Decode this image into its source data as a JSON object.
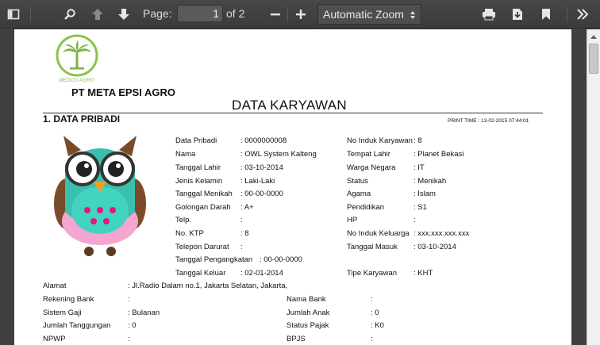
{
  "toolbar": {
    "page_label": "Page:",
    "page_value": "1",
    "page_count": "of 2",
    "zoom_value": "Automatic Zoom",
    "icons": [
      "sidebar-toggle-icon",
      "search-icon",
      "previous-page-icon",
      "next-page-icon",
      "zoom-out-icon",
      "zoom-in-icon",
      "print-icon",
      "download-icon",
      "bookmark-icon",
      "tools-icon"
    ]
  },
  "document": {
    "logo_text": "MEDCO AGRO",
    "company": "PT META EPSI AGRO",
    "title": "DATA KARYAWAN",
    "section": "1. DATA PRIBADI",
    "print_time": "PRINT TIME : 13-02-2015 07:44:01",
    "left_fields": [
      {
        "label": "Data Pribadi",
        "value": ": 0000000008"
      },
      {
        "label": "Nama",
        "value": ": OWL System Kalteng"
      },
      {
        "label": "Tanggal Lahir",
        "value": ": 03-10-2014"
      },
      {
        "label": "Jenis Kelamin",
        "value": ": Laki-Laki"
      },
      {
        "label": "Tanggal Menikah",
        "value": ": 00-00-0000"
      },
      {
        "label": "Golongan Darah",
        "value": ": A+"
      },
      {
        "label": "Telp.",
        "value": ":"
      },
      {
        "label": "No. KTP",
        "value": ": 8"
      },
      {
        "label": "Telepon Darurat",
        "value": ":"
      },
      {
        "label": "Tanggal Pengangkatan",
        "value": ": 00-00-0000"
      },
      {
        "label": "Tanggal Keluar",
        "value": ": 02-01-2014"
      }
    ],
    "right_fields": [
      {
        "label": "No Induk Karyawan",
        "value": ": 8"
      },
      {
        "label": "Tempat Lahir",
        "value": ": Planet Bekasi"
      },
      {
        "label": "Warga Negara",
        "value": ": IT"
      },
      {
        "label": "Status",
        "value": ": Menikah"
      },
      {
        "label": "Agama",
        "value": ": Islam"
      },
      {
        "label": "Pendidikan",
        "value": ": S1"
      },
      {
        "label": "HP",
        "value": ":"
      },
      {
        "label": "No Induk Keluarga",
        "value": ": xxx.xxx.xxx.xxx"
      },
      {
        "label": "Tanggal Masuk",
        "value": ": 03-10-2014"
      },
      {
        "label": "Tipe Karyawan",
        "value": ": KHT"
      }
    ],
    "bottom_left": [
      {
        "label": "Alamat",
        "value": ": Jl.Radio Dalam no.1, Jakarta Selatan, Jakarta,"
      },
      {
        "label": "Rekening Bank",
        "value": ":"
      },
      {
        "label": "Sistem Gaji",
        "value": ": Bulanan"
      },
      {
        "label": "Jumlah Tanggungan",
        "value": ": 0"
      },
      {
        "label": "NPWP",
        "value": ":"
      }
    ],
    "bottom_right": [
      {
        "label": "Nama Bank",
        "value": ":"
      },
      {
        "label": "Jumlah Anak",
        "value": ": 0"
      },
      {
        "label": "Status Pajak",
        "value": ": K0"
      },
      {
        "label": "BPJS",
        "value": ":"
      }
    ]
  }
}
